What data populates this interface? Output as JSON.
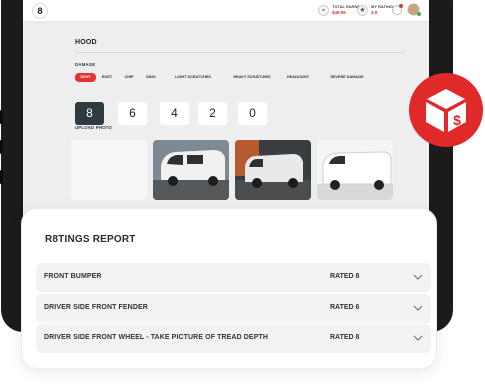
{
  "app": {
    "logo_text": "8",
    "total_earned": {
      "label": "TOTAL EARNED",
      "value": "$49.99",
      "icon": "wallet-icon"
    },
    "my_rating": {
      "label": "MY RATING",
      "value": "4.9",
      "icon": "star-icon"
    },
    "notification_icon": "bell-icon",
    "avatar_icon": "user-avatar"
  },
  "inspection": {
    "title": "HOOD",
    "damage_label": "DAMAGE",
    "damage_types": [
      "DENT",
      "RUST",
      "CHIP",
      "DING",
      "LIGHT SCRATCHES",
      "HEAVY SCRATCHES",
      "HEADLIGHT",
      "SEVERE DAMAGE"
    ],
    "selected_damage": "DENT",
    "ratings": [
      "8",
      "6",
      "4",
      "2",
      "0"
    ],
    "selected_rating": "8",
    "upload_label": "UPLOAD PHOTO"
  },
  "badge": {
    "icon": "box-dollar-icon",
    "symbol": "$",
    "color": "#e02a2a"
  },
  "report": {
    "title": "R8TINGS REPORT",
    "rows": [
      {
        "name": "FRONT BUMPER",
        "rating": "RATED 8"
      },
      {
        "name": "DRIVER SIDE FRONT FENDER",
        "rating": "RATED 6"
      },
      {
        "name": "DRIVER SIDE FRONT WHEEL - TAKE PICTURE OF TREAD DEPTH",
        "rating": "RATED 8"
      }
    ]
  },
  "colors": {
    "accent": "#e23232",
    "dark": "#2f3940"
  }
}
